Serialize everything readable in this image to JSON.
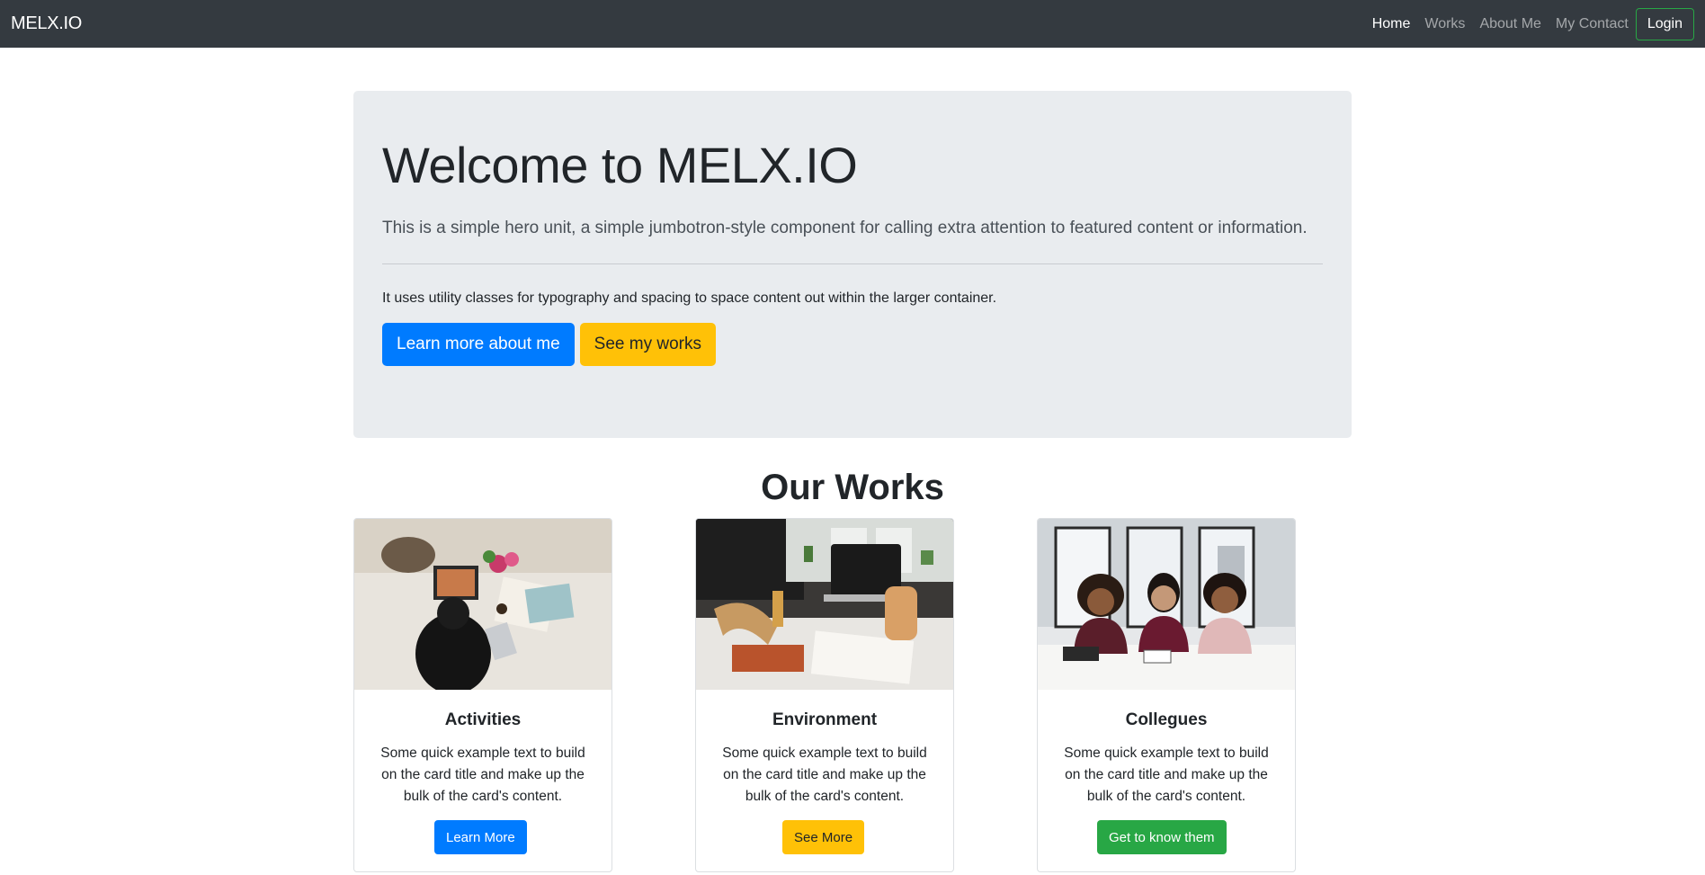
{
  "navbar": {
    "brand": "MELX.IO",
    "links": [
      "Home",
      "Works",
      "About Me",
      "My Contact"
    ],
    "login_label": "Login"
  },
  "hero": {
    "title": "Welcome to MELX.IO",
    "lead": "This is a simple hero unit, a simple jumbotron-style component for calling extra attention to featured content or information.",
    "body": "It uses utility classes for typography and spacing to space content out within the larger container.",
    "primary_button": "Learn more about me",
    "secondary_button": "See my works"
  },
  "works": {
    "title": "Our Works",
    "cards": [
      {
        "title": "Activities",
        "text": "Some quick example text to build on the card title and make up the bulk of the card's content.",
        "button": "Learn More",
        "button_color": "#007bff"
      },
      {
        "title": "Environment",
        "text": "Some quick example text to build on the card title and make up the bulk of the card's content.",
        "button": "See More",
        "button_color": "#ffc107"
      },
      {
        "title": "Collegues",
        "text": "Some quick example text to build on the card title and make up the bulk of the card's content.",
        "button": "Get to know them",
        "button_color": "#28a745"
      }
    ]
  },
  "colors": {
    "navbar_bg": "#343a40",
    "jumbotron_bg": "#e9ecef",
    "primary": "#007bff",
    "warning": "#ffc107",
    "success": "#28a745"
  }
}
